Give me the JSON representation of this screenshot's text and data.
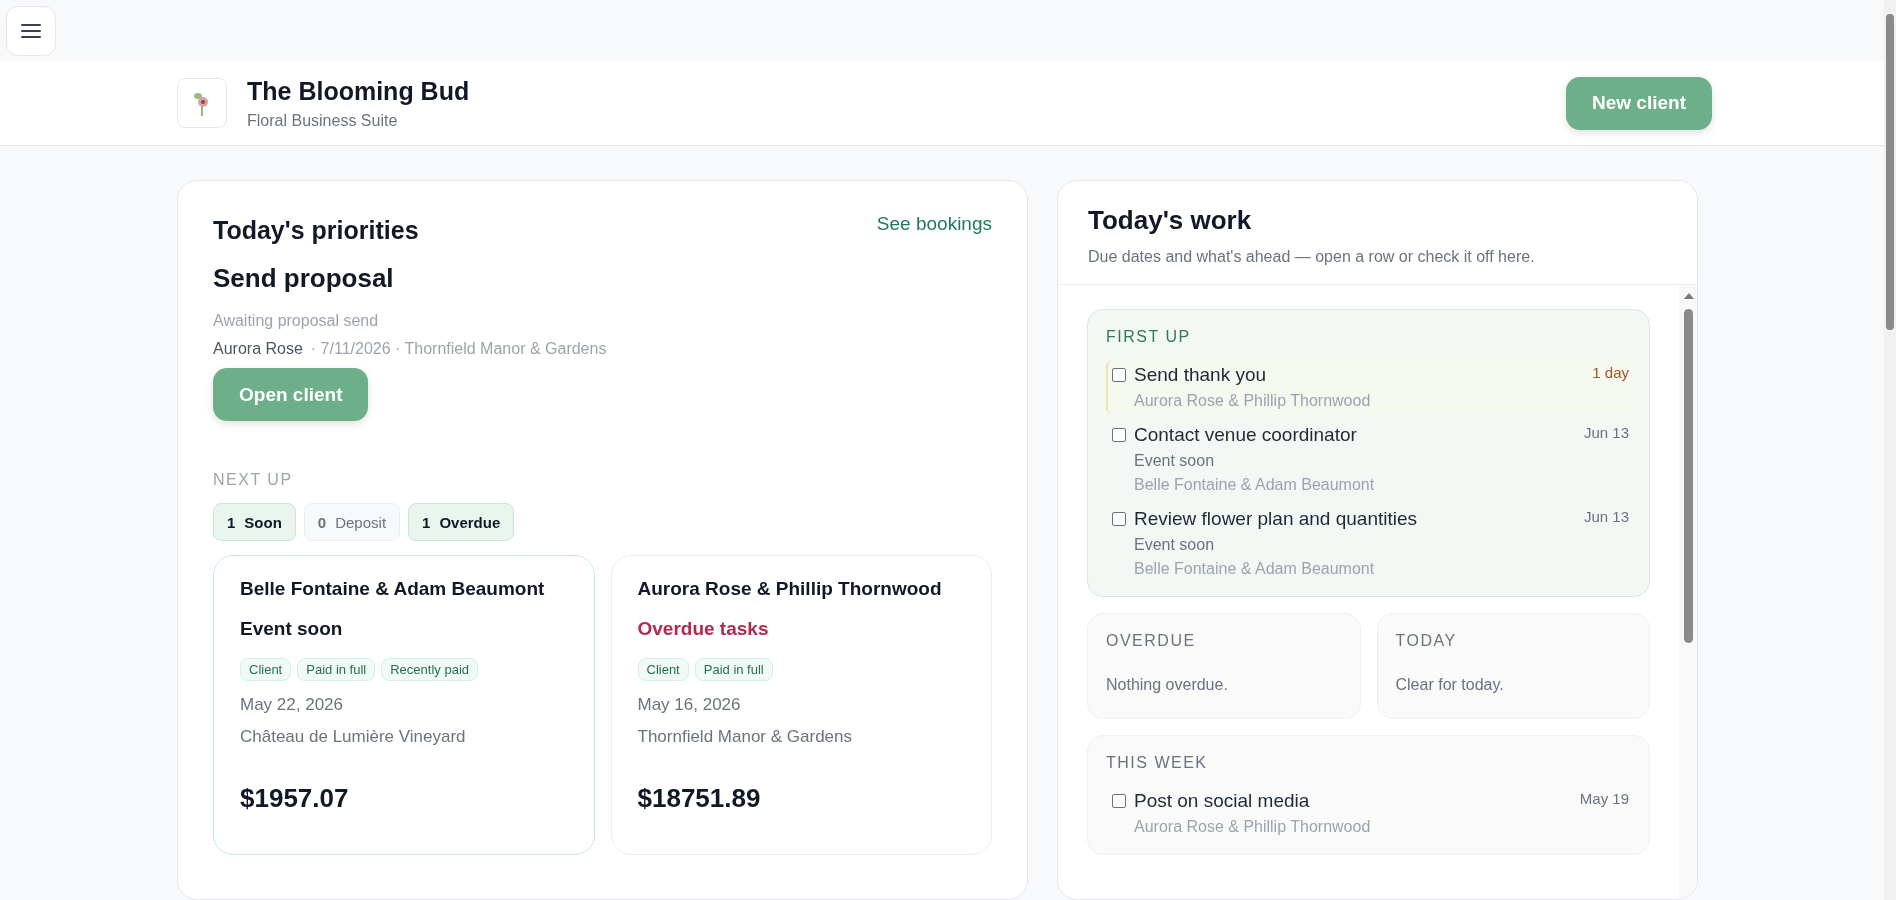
{
  "header": {
    "title": "The Blooming Bud",
    "subtitle": "Floral Business Suite",
    "new_client_button": "New client"
  },
  "priorities": {
    "title": "Today's priorities",
    "link": "See bookings",
    "task": "Send proposal",
    "status": "Awaiting proposal send",
    "client": "Aurora Rose",
    "meta": "· 7/11/2026 · Thornfield Manor & Gardens",
    "open_button": "Open client",
    "next_up_label": "NEXT UP",
    "chips": [
      {
        "count": "1",
        "label": "Soon",
        "active": true
      },
      {
        "count": "0",
        "label": "Deposit",
        "active": false
      },
      {
        "count": "1",
        "label": "Overdue",
        "active": true
      }
    ],
    "bookings": [
      {
        "names": "Belle Fontaine & Adam Beaumont",
        "status": "Event soon",
        "alert": false,
        "selected": true,
        "tags": [
          "Client",
          "Paid in full",
          "Recently paid"
        ],
        "date": "May 22, 2026",
        "venue": "Château de Lumière Vineyard",
        "amount": "$1957.07"
      },
      {
        "names": "Aurora Rose & Phillip Thornwood",
        "status": "Overdue tasks",
        "alert": true,
        "selected": false,
        "tags": [
          "Client",
          "Paid in full"
        ],
        "date": "May 16, 2026",
        "venue": "Thornfield Manor & Gardens",
        "amount": "$18751.89"
      }
    ]
  },
  "work": {
    "title": "Today's work",
    "subtitle": "Due dates and what's ahead — open a row or check it off here.",
    "first_up": {
      "label": "FIRST UP",
      "tasks": [
        {
          "title": "Send thank you",
          "due": "1 day",
          "highlighted": true,
          "checked": false,
          "lines": [
            "Aurora Rose & Phillip Thornwood"
          ]
        },
        {
          "title": "Contact venue coordinator",
          "due": "Jun 13",
          "highlighted": false,
          "checked": false,
          "lines": [
            "Event soon",
            "Belle Fontaine & Adam Beaumont"
          ]
        },
        {
          "title": "Review flower plan and quantities",
          "due": "Jun 13",
          "highlighted": false,
          "checked": false,
          "lines": [
            "Event soon",
            "Belle Fontaine & Adam Beaumont"
          ]
        }
      ]
    },
    "overdue": {
      "label": "OVERDUE",
      "empty": "Nothing overdue."
    },
    "today": {
      "label": "TODAY",
      "empty": "Clear for today."
    },
    "this_week": {
      "label": "THIS WEEK",
      "tasks": [
        {
          "title": "Post on social media",
          "due": "May 19",
          "highlighted": false,
          "checked": false,
          "lines": [
            "Aurora Rose & Phillip Thornwood"
          ]
        }
      ]
    }
  }
}
